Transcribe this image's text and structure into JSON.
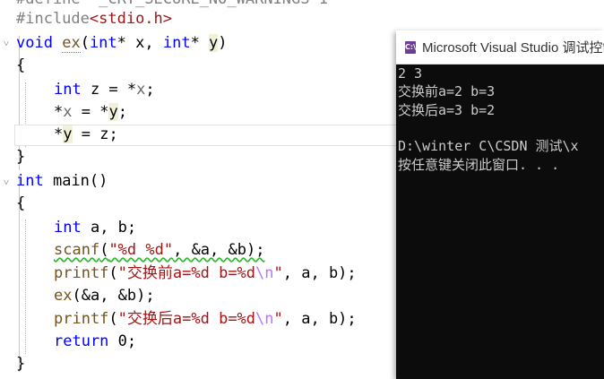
{
  "editor": {
    "lines": {
      "define_partial": "#define  _CRT_SECURE_NO_WARNINGS 1",
      "include_kw": "#include",
      "include_file": "<stdio.h>",
      "l3_void": "void",
      "l3_fn": "ex",
      "l3_open": "(",
      "l3_int1": "int",
      "l3_mid": "* x, ",
      "l3_int2": "int",
      "l3_star": "* ",
      "l3_y": "y",
      "l3_close": ")",
      "brace_open": "{",
      "l5_int": "int",
      "l5_rest_a": " z = *",
      "l5_x": "x",
      "l5_end": ";",
      "l6_star": "*",
      "l6_x": "x",
      "l6_mid": " = *",
      "l6_y": "y",
      "l6_end": ";",
      "l7_star": "*",
      "l7_y": "y",
      "l7_end": " = z;",
      "brace_close": "}",
      "main_int": "int",
      "main_rest": " main()",
      "m_int": "int",
      "m_decl": " a, b;",
      "scanf_fn": "scanf",
      "scanf_open": "(",
      "scanf_fmt": "\"%d %d\"",
      "scanf_args": ", &a, &b);",
      "printf1_fn": "printf",
      "printf1_open": "(",
      "printf1_fmt": "\"交换前a=%d b=%d",
      "printf1_esc": "\\n",
      "printf1_q": "\"",
      "printf1_args": ", a, b);",
      "ex_call": "ex",
      "ex_args": "(&a, &b);",
      "printf2_fn": "printf",
      "printf2_open": "(",
      "printf2_fmt": "\"交换后a=%d b=%d",
      "printf2_esc": "\\n",
      "printf2_q": "\"",
      "printf2_args": ", a, b);",
      "return_kw": "return",
      "return_rest": " 0;"
    }
  },
  "console": {
    "title": "Microsoft Visual Studio 调试控制台",
    "icon_label": "C:\\",
    "output": [
      "2 3",
      "交换前a=2 b=3",
      "交换后a=3 b=2",
      "",
      "D:\\winter C\\CSDN 测试\\x",
      "按任意键关闭此窗口. . ."
    ]
  },
  "colors": {
    "keyword": "#0000ff",
    "string": "#a31515",
    "escape": "#b776fb",
    "function": "#74531f",
    "console_bg": "#0c0c0c",
    "console_text": "#cccccc",
    "vs_icon": "#6c3f97"
  }
}
